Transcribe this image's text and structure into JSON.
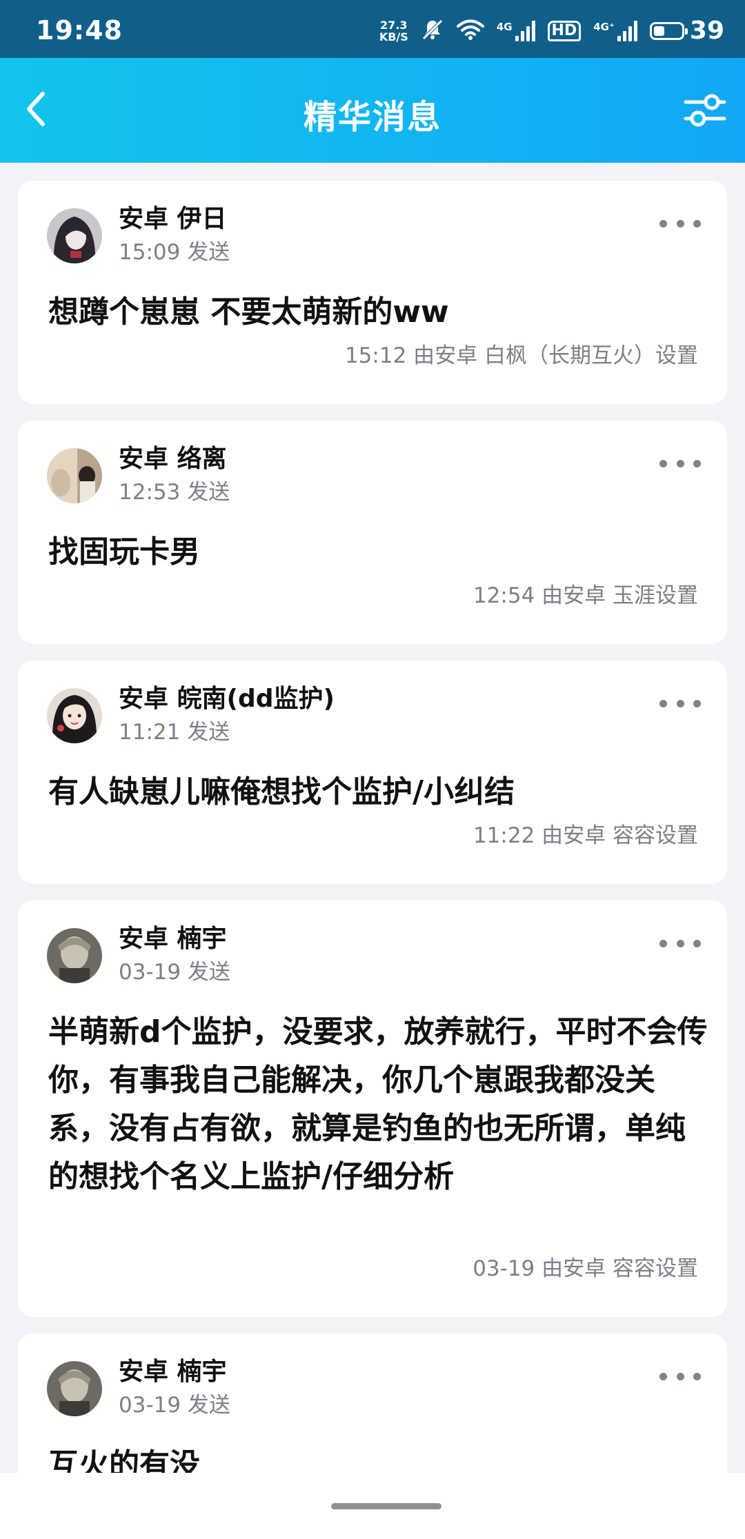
{
  "status_bar": {
    "time": "19:48",
    "net_speed_value": "27.3",
    "net_speed_unit": "KB/S",
    "signal1_tag": "4G",
    "hd_label": "HD",
    "signal2_tag": "4G⁺",
    "battery_percent": "39",
    "battery_level": 0.39
  },
  "nav": {
    "title": "精华消息",
    "back_icon": "chevron-left-icon",
    "filter_icon": "filter-sliders-icon"
  },
  "messages": [
    {
      "author": "安卓 伊日",
      "sent": "15:09 发送",
      "content": "想蹲个崽崽 不要太萌新的ww",
      "setter": "15:12 由安卓 白枫（长期互火）设置"
    },
    {
      "author": "安卓 络离",
      "sent": "12:53 发送",
      "content": "找固玩卡男",
      "setter": "12:54 由安卓 玉涯设置"
    },
    {
      "author": "安卓 皖南(dd监护)",
      "sent": "11:21 发送",
      "content": "有人缺崽儿嘛俺想找个监护/小纠结",
      "setter": "11:22 由安卓 容容设置"
    },
    {
      "author": "安卓 楠宇",
      "sent": "03-19 发送",
      "content": "半萌新d个监护，没要求，放养就行，平时不会传你，有事我自己能解决，你几个崽跟我都没关系，没有占有欲，就算是钓鱼的也无所谓，单纯的想找个名义上监护/仔细分析",
      "setter": "03-19 由安卓 容容设置"
    },
    {
      "author": "安卓 楠宇",
      "sent": "03-19 发送",
      "content": "互火的有没"
    }
  ]
}
